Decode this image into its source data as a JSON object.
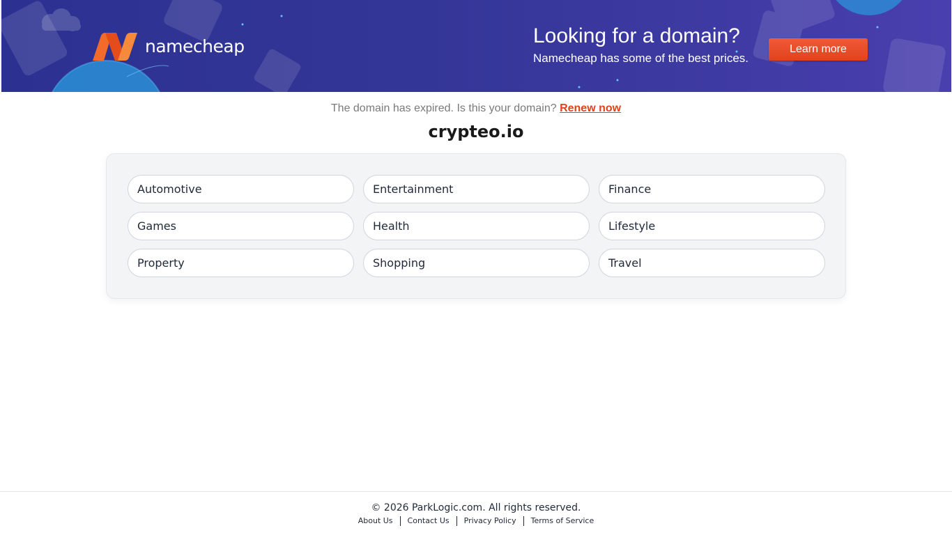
{
  "banner": {
    "logo_text": "namecheap",
    "title": "Looking for a domain?",
    "subtitle": "Namecheap has some of the best prices.",
    "cta_label": "Learn more",
    "colors": {
      "background": "#343697",
      "accent": "#e0421f",
      "logo_orange": "#f26b2a"
    }
  },
  "notice": {
    "text": "The domain has expired. Is this your domain?",
    "link_label": "Renew now"
  },
  "domain": "crypteo.io",
  "categories": [
    "Automotive",
    "Entertainment",
    "Finance",
    "Games",
    "Health",
    "Lifestyle",
    "Property",
    "Shopping",
    "Travel"
  ],
  "footer": {
    "copyright": "© 2026 ParkLogic.com. All rights reserved.",
    "links": [
      "About Us",
      "Contact Us",
      "Privacy Policy",
      "Terms of Service"
    ]
  }
}
